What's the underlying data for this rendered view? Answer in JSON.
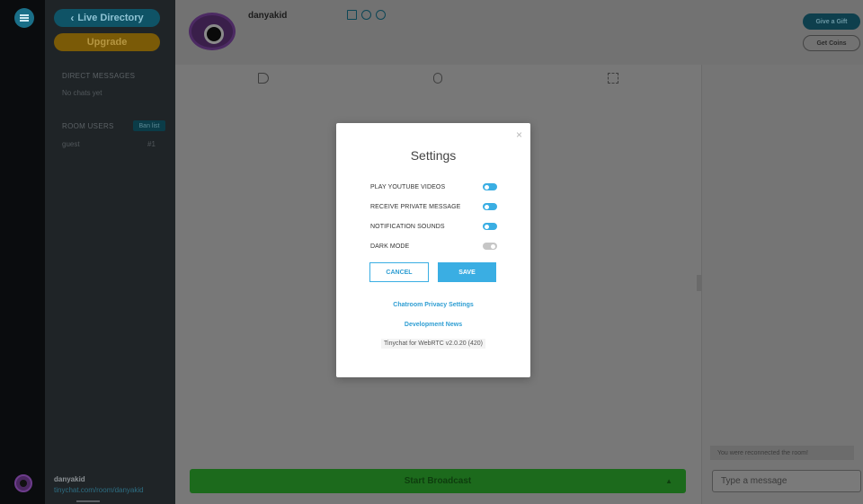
{
  "sidebar": {
    "live_directory": "Live Directory",
    "upgrade": "Upgrade",
    "direct_messages_label": "DIRECT MESSAGES",
    "no_chats": "No chats yet",
    "room_users_label": "ROOM USERS",
    "ban_list": "Ban list",
    "guest_label": "guest",
    "guest_count": "#1",
    "username": "danyakid",
    "room_link": "tinychat.com/room/danyakid"
  },
  "topbar": {
    "broadcaster_name": "danyakid",
    "give_gift": "Give a Gift",
    "get_coins": "Get Coins"
  },
  "stage": {
    "start_broadcast": "Start Broadcast",
    "caret": "▲"
  },
  "chat": {
    "notice": "You were reconnected the room!",
    "input_placeholder": "Type a message"
  },
  "modal": {
    "close": "×",
    "title": "Settings",
    "options": [
      {
        "label": "PLAY YOUTUBE VIDEOS",
        "enabled": true
      },
      {
        "label": "RECEIVE PRIVATE MESSAGE",
        "enabled": true
      },
      {
        "label": "NOTIFICATION SOUNDS",
        "enabled": true
      },
      {
        "label": "DARK MODE",
        "enabled": false
      }
    ],
    "cancel": "CANCEL",
    "save": "SAVE",
    "privacy_link": "Chatroom Privacy Settings",
    "news_link": "Development News",
    "version": "Tinychat for WebRTC v2.0.20 (420)"
  },
  "colors": {
    "accent": "#3aaee3",
    "toggle_off": "#c6c6c6",
    "broadcast_green": "#1c6a1c"
  }
}
